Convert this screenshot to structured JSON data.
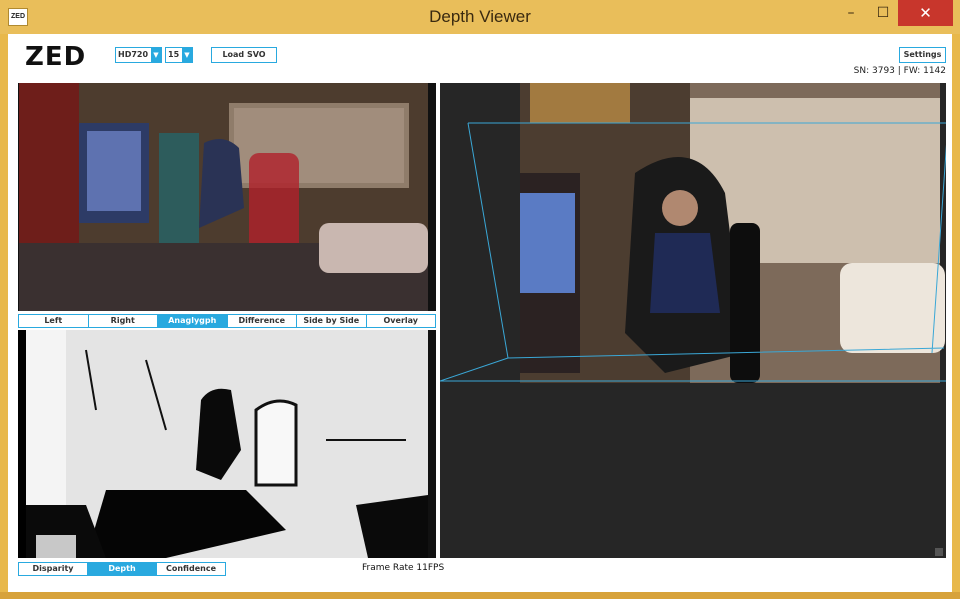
{
  "window": {
    "title": "Depth Viewer",
    "icon_text": "ZED",
    "minimize": "–",
    "maximize": "☐",
    "close": "✕"
  },
  "toolbar": {
    "logo": "ZED",
    "resolution": "HD720",
    "fps": "15",
    "load_svo": "Load SVO",
    "settings": "Settings",
    "serial": "SN: 3793 | FW: 1142"
  },
  "view_tabs": [
    {
      "label": "Left",
      "active": false
    },
    {
      "label": "Right",
      "active": false
    },
    {
      "label": "Anaglygph",
      "active": true
    },
    {
      "label": "Difference",
      "active": false
    },
    {
      "label": "Side by Side",
      "active": false
    },
    {
      "label": "Overlay",
      "active": false
    }
  ],
  "depth_tabs": [
    {
      "label": "Disparity",
      "active": false
    },
    {
      "label": "Depth",
      "active": true
    },
    {
      "label": "Confidence",
      "active": false
    }
  ],
  "status": {
    "frame_rate": "Frame Rate 11FPS"
  },
  "colors": {
    "accent": "#29a9df",
    "title_bar": "#e9be5a",
    "close": "#c8362c"
  }
}
